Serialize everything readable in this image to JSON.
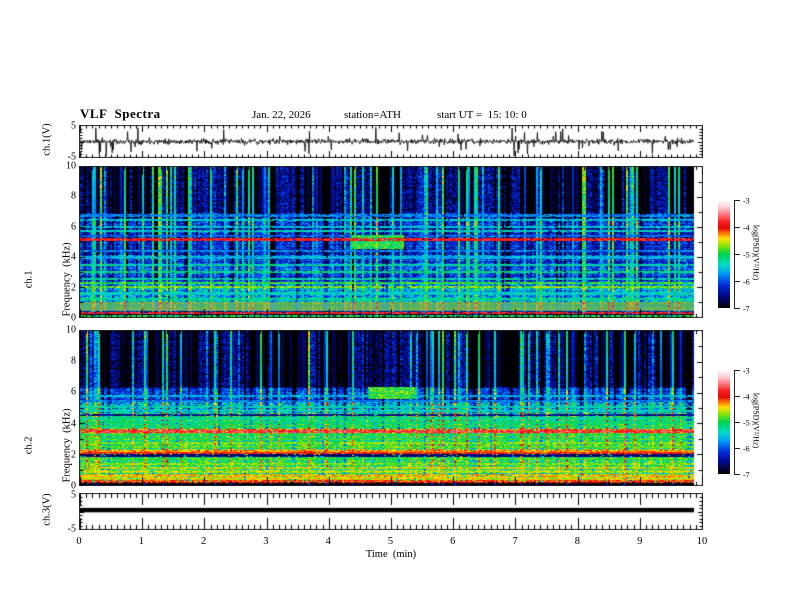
{
  "header": {
    "title": "VLF  Spectra",
    "date": "Jan. 22, 2026",
    "station": "station=ATH",
    "start_ut": "start UT =  15: 10: 0"
  },
  "panels": {
    "ch1_wave": {
      "ylabel": "ch.1(V)",
      "y_ticks": [
        "5",
        "-5"
      ]
    },
    "ch1_spec": {
      "ylabel_channel": "ch.1",
      "ylabel_axis": "Frequency  (kHz)",
      "y_ticks": [
        "10",
        "8",
        "6",
        "4",
        "2",
        "0"
      ]
    },
    "ch2_spec": {
      "ylabel_channel": "ch.2",
      "ylabel_axis": "Frequency  (kHz)",
      "y_ticks": [
        "10",
        "8",
        "6",
        "4",
        "2",
        "0"
      ]
    },
    "ch3_wave": {
      "ylabel": "ch.3(V)",
      "y_ticks": [
        "5",
        "-5"
      ]
    }
  },
  "time_axis": {
    "label": "Time  (min)",
    "ticks": [
      "0",
      "1",
      "2",
      "3",
      "4",
      "5",
      "6",
      "7",
      "8",
      "9",
      "10"
    ],
    "range_min": [
      0,
      10
    ]
  },
  "colorbar": {
    "unit": "log(PSD)(V²/Hz)",
    "ticks": [
      "-3",
      "-4",
      "-5",
      "-6",
      "-7"
    ],
    "value_range": [
      -3,
      -7
    ],
    "stops": [
      {
        "p": 0.0,
        "c": "#ffffff"
      },
      {
        "p": 0.07,
        "c": "#ffc9d4"
      },
      {
        "p": 0.14,
        "c": "#ff6e76"
      },
      {
        "p": 0.2,
        "c": "#fa2020"
      },
      {
        "p": 0.26,
        "c": "#e00808"
      },
      {
        "p": 0.31,
        "c": "#ff7a00"
      },
      {
        "p": 0.36,
        "c": "#ffe000"
      },
      {
        "p": 0.42,
        "c": "#8ce600"
      },
      {
        "p": 0.5,
        "c": "#00d24b"
      },
      {
        "p": 0.6,
        "c": "#00dcc8"
      },
      {
        "p": 0.68,
        "c": "#009cf5"
      },
      {
        "p": 0.78,
        "c": "#0032e1"
      },
      {
        "p": 0.87,
        "c": "#000a96"
      },
      {
        "p": 0.95,
        "c": "#05043c"
      },
      {
        "p": 1.0,
        "c": "#000000"
      }
    ]
  },
  "chart_data": [
    {
      "type": "line",
      "panel": "ch1_waveform",
      "x_range_min": [
        0,
        10
      ],
      "y_range_V": [
        -5,
        5
      ],
      "description": "continuous broadband noise of roughly ±1 V with frequent impulsive spikes reaching about ±4 V",
      "gen": {
        "seed": 11,
        "n_points": 1240,
        "noise_sigma": 0.4,
        "spike_count": 95,
        "spike_min": 0.7,
        "spike_max": 4.3,
        "data_end_min": 9.82
      }
    },
    {
      "type": "heatmap",
      "panel": "ch1_spectrogram",
      "x_range_min": [
        0,
        10
      ],
      "y_range_kHz": [
        0,
        10
      ],
      "z_log_psd_range": [
        -7,
        -3
      ],
      "description": "VLF spectrogram: dark/black columns above 7 kHz, blue background with dense vertical green/cyan sferic streaks, olive band 0.5-1 kHz, red line near 5.2 kHz, cyan patch near t=4.7-5.1 min at 5 kHz, black band below 0.25 kHz",
      "gen": {
        "seed": 42,
        "data_end_min": 9.82,
        "bands": [
          [
            0,
            0.25,
            -7,
            0.08,
            0
          ],
          [
            0.25,
            0.45,
            -6.5,
            0.3,
            0
          ],
          [
            0.45,
            1.05,
            -4.95,
            0.18,
            1
          ],
          [
            1.05,
            2.35,
            -5.65,
            0.45,
            0
          ],
          [
            2.35,
            4.2,
            -6.1,
            0.4,
            0
          ],
          [
            4.2,
            5.5,
            -6.35,
            0.35,
            0
          ],
          [
            5.5,
            7,
            -6.15,
            0.4,
            0
          ],
          [
            7,
            10,
            -6.55,
            0.4,
            0
          ]
        ],
        "hlines": [
          [
            0.12,
            -5.0
          ],
          [
            0.3,
            -3.9
          ],
          [
            1.25,
            -5.2
          ],
          [
            1.6,
            -5.4
          ],
          [
            2.05,
            -4.7
          ],
          [
            2.3,
            -4.9
          ],
          [
            2.55,
            -5.3
          ],
          [
            3.05,
            -5.15
          ],
          [
            3.5,
            -5.3
          ],
          [
            4.0,
            -5.6
          ],
          [
            4.45,
            -5.8
          ],
          [
            5.2,
            -3.9
          ],
          [
            5.45,
            -5.9
          ],
          [
            5.75,
            -5.4
          ],
          [
            6.05,
            -5.5
          ],
          [
            6.5,
            -5.45
          ],
          [
            6.8,
            -5.8
          ]
        ],
        "blobs": [
          {
            "t0": 4.35,
            "t1": 5.15,
            "f0": 4.6,
            "f1": 5.5,
            "level": -5.0
          }
        ],
        "streaks": {
          "p_bright": 0.2,
          "bright_min": 0.7,
          "bright_max": 2.1,
          "p_dark": 0.13,
          "dark_drop": 1.1
        },
        "dark_intervals": {
          "count": 26,
          "w_min": 0.04,
          "w_max": 0.28,
          "f_min": 6.6
        }
      }
    },
    {
      "type": "heatmap",
      "panel": "ch2_spectrogram",
      "x_range_min": [
        0,
        10
      ],
      "y_range_kHz": [
        0,
        10
      ],
      "z_log_psd_range": [
        -7,
        -3
      ],
      "description": "VLF spectrogram: dark columns above 6.3 kHz with vertical streaks, green-dominated below 5.5 kHz with many horizontal lines, yellow band near 2.1 kHz, red band near 3.5 kHz, bright patch near t=5 min at 6 kHz, black band below 0.2 kHz",
      "gen": {
        "seed": 77,
        "data_end_min": 9.82,
        "bands": [
          [
            0,
            0.2,
            -7,
            0.08,
            0
          ],
          [
            0.2,
            2.0,
            -5.15,
            0.4,
            0
          ],
          [
            2.0,
            2.35,
            -4.5,
            0.3,
            0
          ],
          [
            2.35,
            3.4,
            -5.0,
            0.35,
            0
          ],
          [
            3.4,
            3.65,
            -4.65,
            0.4,
            0
          ],
          [
            3.65,
            4.7,
            -5.2,
            0.4,
            0
          ],
          [
            4.7,
            5.4,
            -5.55,
            0.55,
            0
          ],
          [
            5.4,
            6.3,
            -6.1,
            0.35,
            0
          ],
          [
            6.3,
            10,
            -6.6,
            0.38,
            0
          ]
        ],
        "hlines": [
          [
            0.25,
            -4.1
          ],
          [
            0.45,
            -4.5
          ],
          [
            0.65,
            -4.4
          ],
          [
            0.9,
            -4.6
          ],
          [
            1.15,
            -4.5
          ],
          [
            1.4,
            -4.7
          ],
          [
            1.7,
            -4.85
          ],
          [
            1.95,
            -6.6
          ],
          [
            2.1,
            -4.0
          ],
          [
            2.25,
            -4.3
          ],
          [
            2.5,
            -4.8
          ],
          [
            2.75,
            -4.7
          ],
          [
            3.0,
            -4.9
          ],
          [
            3.3,
            -5.0
          ],
          [
            3.5,
            -3.75
          ],
          [
            3.6,
            -4.2
          ],
          [
            3.85,
            -5.0
          ],
          [
            4.1,
            -5.1
          ],
          [
            4.35,
            -5.2
          ],
          [
            4.6,
            -6.5
          ],
          [
            4.85,
            -5.4
          ],
          [
            5.1,
            -5.35
          ],
          [
            5.5,
            -5.8
          ],
          [
            5.8,
            -5.6
          ]
        ],
        "blobs": [
          {
            "t0": 4.6,
            "t1": 5.35,
            "f0": 5.6,
            "f1": 6.4,
            "level": -4.9
          }
        ],
        "streaks": {
          "p_bright": 0.2,
          "bright_min": 0.7,
          "bright_max": 2.0,
          "p_dark": 0.12,
          "dark_drop": 1.0
        },
        "dark_intervals": {
          "count": 24,
          "w_min": 0.04,
          "w_max": 0.3,
          "f_min": 6.4
        }
      }
    },
    {
      "type": "line",
      "panel": "ch3_waveform",
      "x_range_min": [
        0,
        10
      ],
      "y_range_V": [
        -5,
        5
      ],
      "value_V": 0.4,
      "description": "flat heavy black trace at about +0.4 V for the full record"
    }
  ]
}
